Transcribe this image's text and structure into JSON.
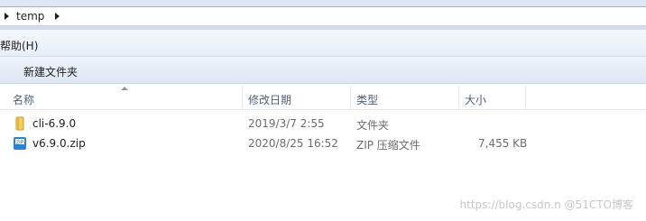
{
  "address": {
    "crumb": "temp"
  },
  "menu": {
    "help": "帮助(H)"
  },
  "toolbar": {
    "new_folder": "新建文件夹"
  },
  "columns": {
    "name": "名称",
    "modified": "修改日期",
    "type": "类型",
    "size": "大小"
  },
  "files": [
    {
      "name": "cli-6.9.0",
      "modified": "2019/3/7 2:55",
      "type": "文件夹",
      "size": "",
      "icon": "folder-icon"
    },
    {
      "name": "v6.9.0.zip",
      "modified": "2020/8/25 16:52",
      "type": "ZIP 压缩文件",
      "size": "7,455 KB",
      "icon": "zip-file-icon"
    }
  ],
  "watermark": "https://blog.csdn.n @51CTO博客",
  "colors": {
    "folder": "#e8b93a",
    "zip": "#2f7fd0"
  }
}
